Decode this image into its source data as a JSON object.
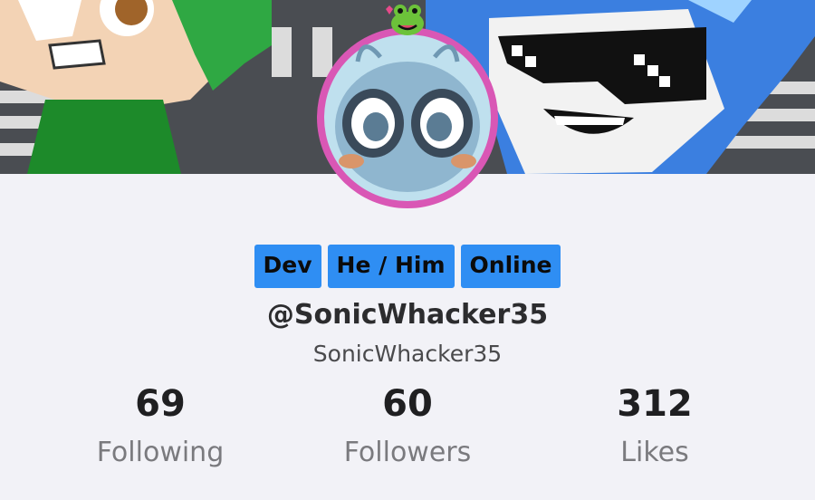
{
  "profile": {
    "tags": [
      "Dev",
      "He / Him",
      "Online"
    ],
    "username": "@SonicWhacker35",
    "display_name": "SonicWhacker35"
  },
  "stats": [
    {
      "value": "69",
      "label": "Following"
    },
    {
      "value": "60",
      "label": "Followers"
    },
    {
      "value": "312",
      "label": "Likes"
    }
  ],
  "colors": {
    "background": "#f2f2f7",
    "tag_bg": "#2f8ef3",
    "avatar_ring": "#d957b5"
  },
  "icons": {
    "avatar_badge": "frog-emoji-icon"
  }
}
